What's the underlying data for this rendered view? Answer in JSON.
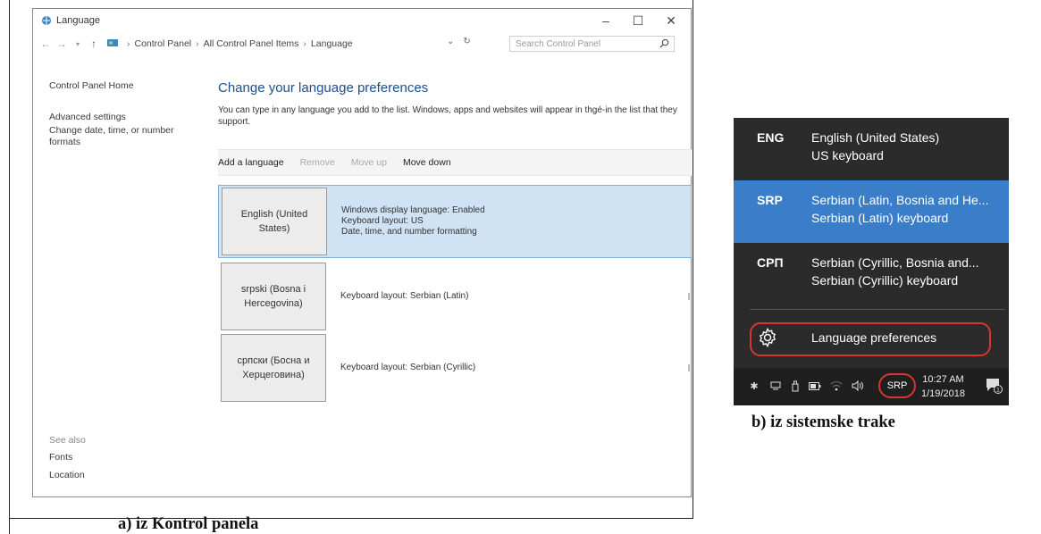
{
  "control_panel": {
    "window_title": "Language",
    "breadcrumb": [
      "Control Panel",
      "All Control Panel Items",
      "Language"
    ],
    "search_placeholder": "Search Control Panel",
    "left_nav": [
      "Control Panel Home",
      "Advanced settings",
      "Change date, time, or number formats"
    ],
    "see_also_label": "See also",
    "see_also_links": [
      "Fonts",
      "Location"
    ],
    "heading": "Change your language preferences",
    "description": "You can type in any language you add to the list. Windows, apps and websites will appear in thgé-in the list that they support.",
    "toolbar": [
      {
        "label": "Add a language",
        "enabled": true
      },
      {
        "label": "Remove",
        "enabled": false
      },
      {
        "label": "Move up",
        "enabled": false
      },
      {
        "label": "Move down",
        "enabled": true
      }
    ],
    "languages": [
      {
        "name": "English (United States)",
        "details": [
          "Windows display language: Enabled",
          "Keyboard layout: US",
          "Date, time, and number formatting"
        ],
        "selected": true
      },
      {
        "name": "srpski (Bosna i Hercegovina)",
        "details": [
          "Keyboard layout: Serbian (Latin)"
        ],
        "selected": false
      },
      {
        "name": "српски (Босна и Херцеговина)",
        "details": [
          "Keyboard layout: Serbian (Cyrillic)"
        ],
        "selected": false
      }
    ],
    "window_controls": [
      "minimize",
      "maximize",
      "close"
    ]
  },
  "flyout": {
    "items": [
      {
        "code": "ENG",
        "line1": "English (United States)",
        "line2": "US keyboard",
        "active": false
      },
      {
        "code": "SRP",
        "line1": "Serbian (Latin, Bosnia and He...",
        "line2": "Serbian (Latin) keyboard",
        "active": true
      },
      {
        "code": "СРП",
        "line1": "Serbian (Cyrillic, Bosnia and...",
        "line2": "Serbian (Cyrillic) keyboard",
        "active": false
      }
    ],
    "preferences_label": "Language preferences",
    "highlight_color": "#3a7dc9",
    "ring_color": "#d9352f"
  },
  "taskbar": {
    "input_indicator": "SRP",
    "time": "10:27 AM",
    "date": "1/19/2018",
    "notification_count": "1",
    "icons": [
      "bluetooth-icon",
      "network-device-icon",
      "usb-icon",
      "battery-icon",
      "wifi-icon",
      "volume-icon"
    ]
  },
  "captions": {
    "a": "a)    iz Kontrol panela",
    "b": "b)    iz sistemske trake"
  }
}
